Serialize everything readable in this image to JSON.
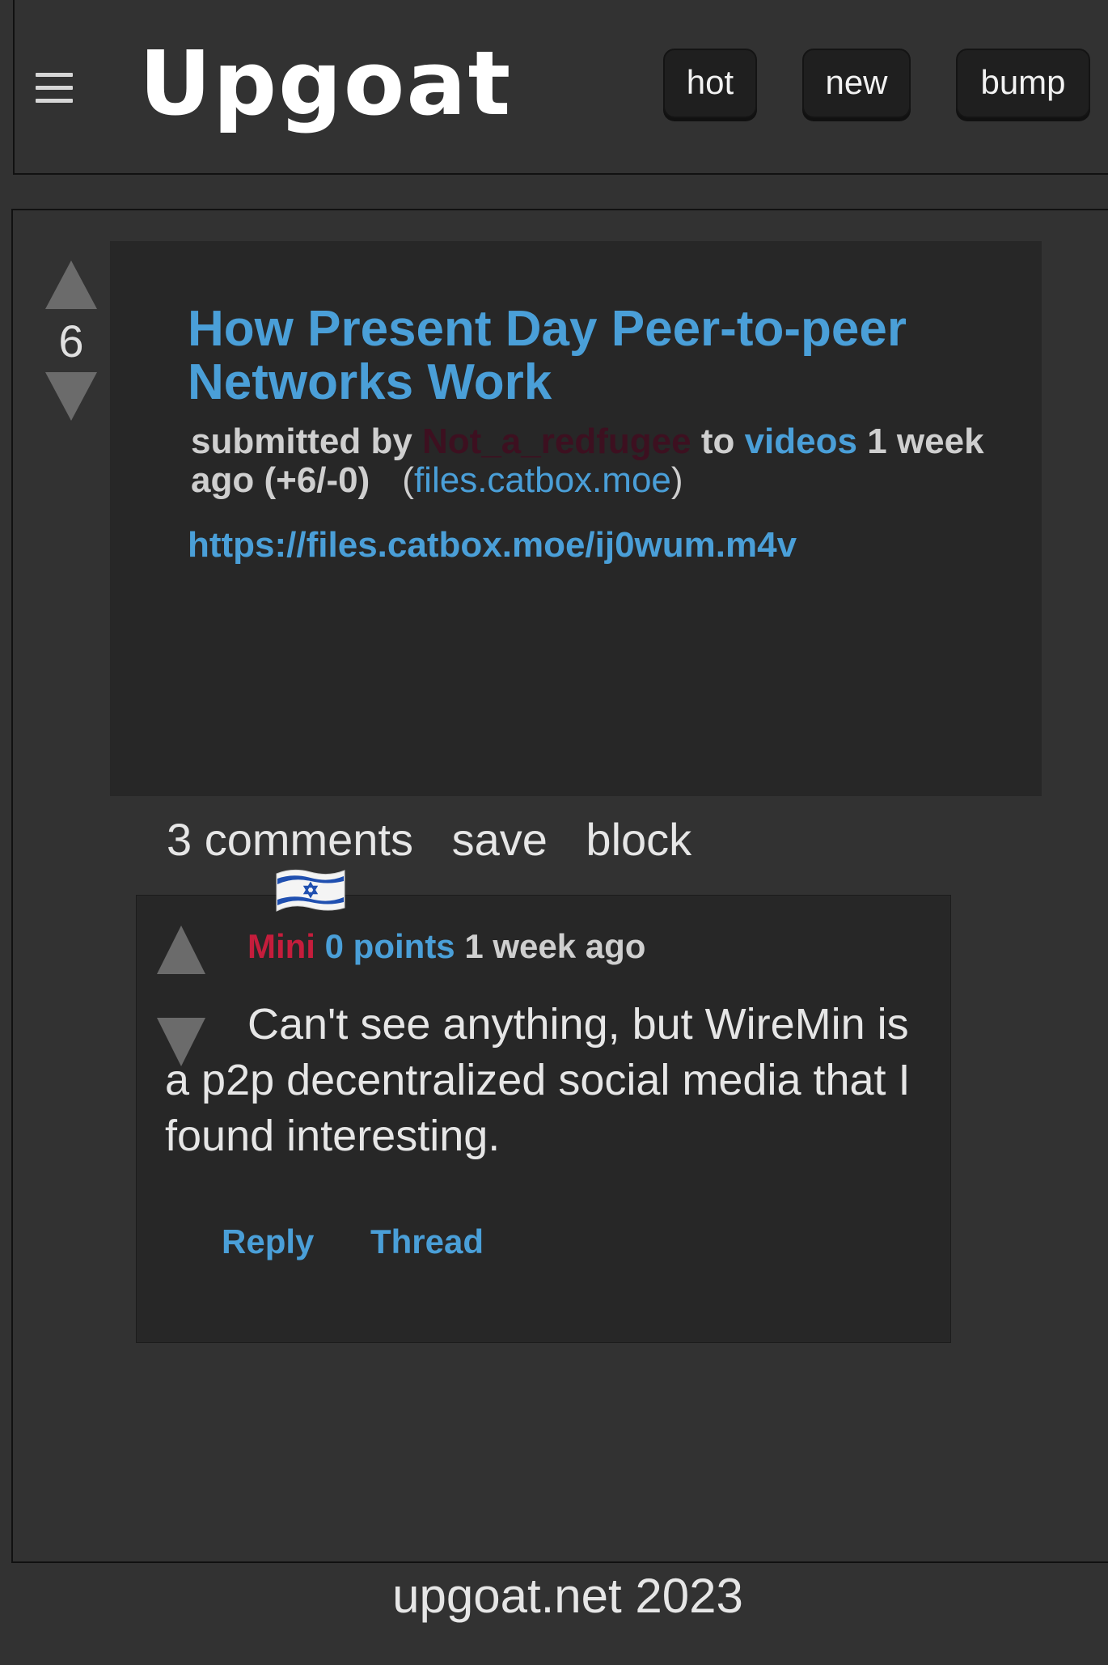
{
  "header": {
    "logo": "Upgoat",
    "sort_tabs": [
      "hot",
      "new",
      "bump"
    ]
  },
  "post": {
    "score": "6",
    "title": "How Present Day Peer-to-peer Networks Work",
    "submitted_by_label": "submitted by",
    "author": "Not_a_redfugee",
    "to_label": "to",
    "subverse": "videos",
    "age": "1 week ago",
    "votes": "(+6/-0)",
    "domain": "files.catbox.moe",
    "url": "https://files.catbox.moe/ij0wum.m4v"
  },
  "actions": {
    "comments": "3 comments",
    "save": "save",
    "block": "block"
  },
  "comment": {
    "author": "Mini",
    "points": "0 points",
    "age": "1 week ago",
    "text": "Can't see anything, but WireMin is a p2p decentralized social media that I found interesting.",
    "reply": "Reply",
    "thread": "Thread",
    "flag_icon": "israel-flag-icon"
  },
  "footer": "upgoat.net 2023"
}
